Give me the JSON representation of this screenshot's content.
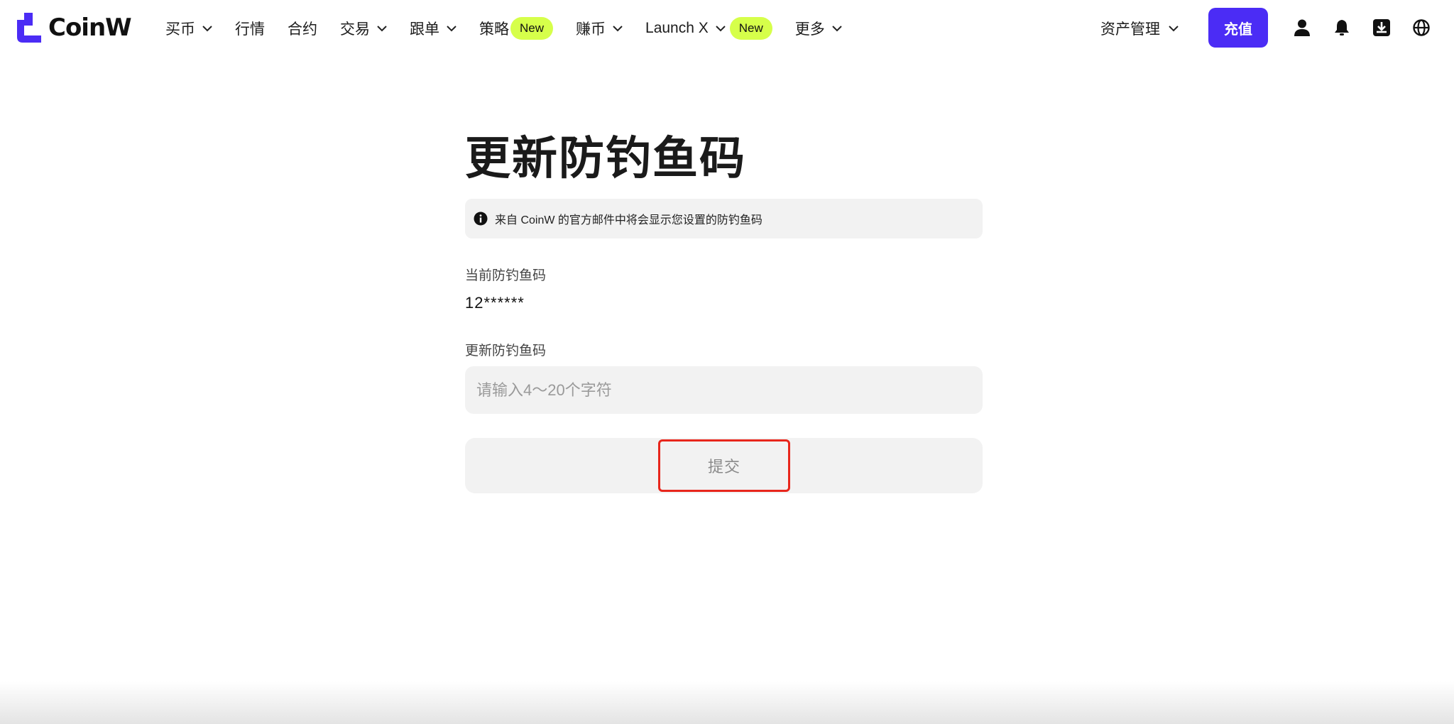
{
  "brand": {
    "name": "CoinW",
    "accent": "#4b2cf5",
    "badge_color": "#d6ff4a"
  },
  "nav": {
    "buy": "买币",
    "market": "行情",
    "contract": "合约",
    "trade": "交易",
    "copy": "跟单",
    "strategy": "策略",
    "strategy_badge": "New",
    "earn": "赚币",
    "launch": "Launch X",
    "launch_badge": "New",
    "more": "更多"
  },
  "header_right": {
    "assets": "资产管理",
    "deposit": "充值",
    "icons": [
      "user-icon",
      "bell-icon",
      "download-icon",
      "globe-icon"
    ]
  },
  "page": {
    "title": "更新防钓鱼码",
    "notice": "来自 CoinW 的官方邮件中将会显示您设置的防钓鱼码",
    "current_label": "当前防钓鱼码",
    "current_value": "12******",
    "new_label": "更新防钓鱼码",
    "input_value": "",
    "input_placeholder": "请输入4～20个字符",
    "submit": "提交"
  }
}
